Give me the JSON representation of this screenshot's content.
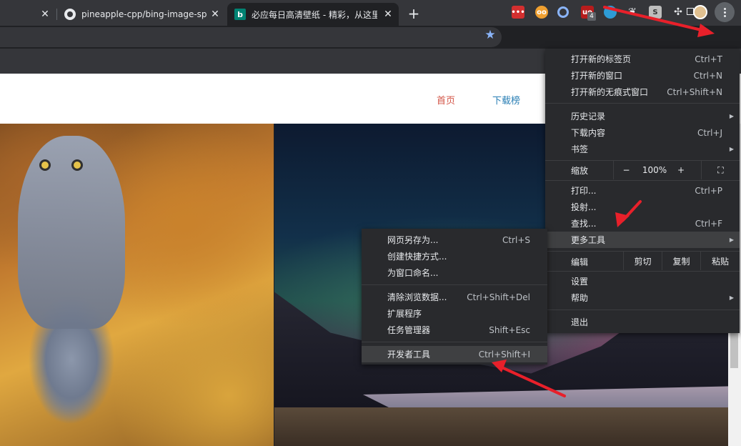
{
  "tabs": [
    {
      "title": ""
    },
    {
      "title": "pineapple-cpp/bing-image-sp"
    },
    {
      "title": "必应每日高清壁纸 - 精彩，从这里"
    }
  ],
  "tab_close_glyph": "✕",
  "new_tab_glyph": "+",
  "extensions": [
    {
      "glyph": "•••"
    },
    {
      "glyph": "oo"
    },
    {
      "glyph": ""
    },
    {
      "glyph": "uo",
      "badge": "4"
    },
    {
      "glyph": ""
    },
    {
      "glyph": "❦"
    },
    {
      "glyph": "S"
    },
    {
      "glyph": "✣"
    }
  ],
  "site": {
    "nav": [
      "首页",
      "下载榜"
    ]
  },
  "menu": {
    "items": [
      {
        "label": "打开新的标签页",
        "shortcut": "Ctrl+T"
      },
      {
        "label": "打开新的窗口",
        "shortcut": "Ctrl+N"
      },
      {
        "label": "打开新的无痕式窗口",
        "shortcut": "Ctrl+Shift+N"
      },
      {
        "label": "历史记录",
        "shortcut": ""
      },
      {
        "label": "下载内容",
        "shortcut": "Ctrl+J"
      },
      {
        "label": "书签",
        "shortcut": ""
      },
      {
        "label": "打印...",
        "shortcut": "Ctrl+P"
      },
      {
        "label": "投射...",
        "shortcut": ""
      },
      {
        "label": "查找...",
        "shortcut": "Ctrl+F"
      },
      {
        "label": "更多工具",
        "shortcut": ""
      },
      {
        "label": "设置",
        "shortcut": ""
      },
      {
        "label": "帮助",
        "shortcut": ""
      },
      {
        "label": "退出",
        "shortcut": ""
      }
    ],
    "zoom": {
      "label": "缩放",
      "minus": "−",
      "value": "100%",
      "plus": "+"
    },
    "edit": {
      "label": "编辑",
      "cut": "剪切",
      "copy": "复制",
      "paste": "粘贴"
    }
  },
  "submenu": {
    "items": [
      {
        "label": "网页另存为...",
        "shortcut": "Ctrl+S"
      },
      {
        "label": "创建快捷方式...",
        "shortcut": ""
      },
      {
        "label": "为窗口命名...",
        "shortcut": ""
      },
      {
        "label": "清除浏览数据...",
        "shortcut": "Ctrl+Shift+Del"
      },
      {
        "label": "扩展程序",
        "shortcut": ""
      },
      {
        "label": "任务管理器",
        "shortcut": "Shift+Esc"
      },
      {
        "label": "开发者工具",
        "shortcut": "Ctrl+Shift+I"
      }
    ]
  },
  "colors": {
    "accent": "#8ab4f8",
    "annotation": "#e8202a",
    "menu_bg": "#292a2d",
    "highlight": "#3f4042"
  }
}
